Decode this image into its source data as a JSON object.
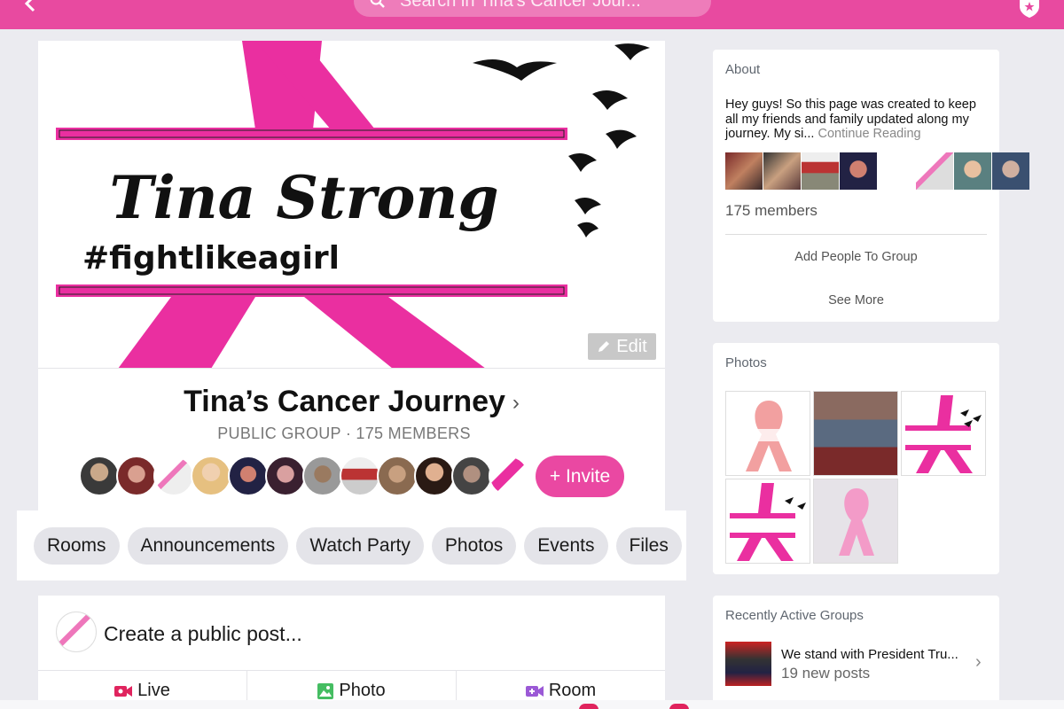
{
  "topbar": {
    "search_placeholder": "Search in Tina's Cancer Jour..."
  },
  "cover": {
    "title_line": "Tina Strong",
    "hashtag": "#fightlikeagirl",
    "edit_label": "Edit",
    "accent_color": "#ea48a2"
  },
  "group": {
    "name": "Tina’s Cancer Journey",
    "subtitle": "PUBLIC GROUP · 175 MEMBERS",
    "invite_label": "+ Invite"
  },
  "tabs": [
    "Rooms",
    "Announcements",
    "Watch Party",
    "Photos",
    "Events",
    "Files"
  ],
  "composer": {
    "prompt": "Create a public post...",
    "actions": [
      "Live",
      "Photo",
      "Room"
    ]
  },
  "about": {
    "heading": "About",
    "text": "Hey guys! So this page was created to keep all my friends and family updated along my journey. My si...",
    "continue_label": " Continue Reading",
    "members": "175 members",
    "add_people": "Add People To Group",
    "see_more": "See More"
  },
  "photos": {
    "heading": "Photos"
  },
  "recent": {
    "heading": "Recently Active Groups",
    "items": [
      {
        "name": "We stand with President Tru...",
        "posts": "19 new posts"
      }
    ]
  }
}
